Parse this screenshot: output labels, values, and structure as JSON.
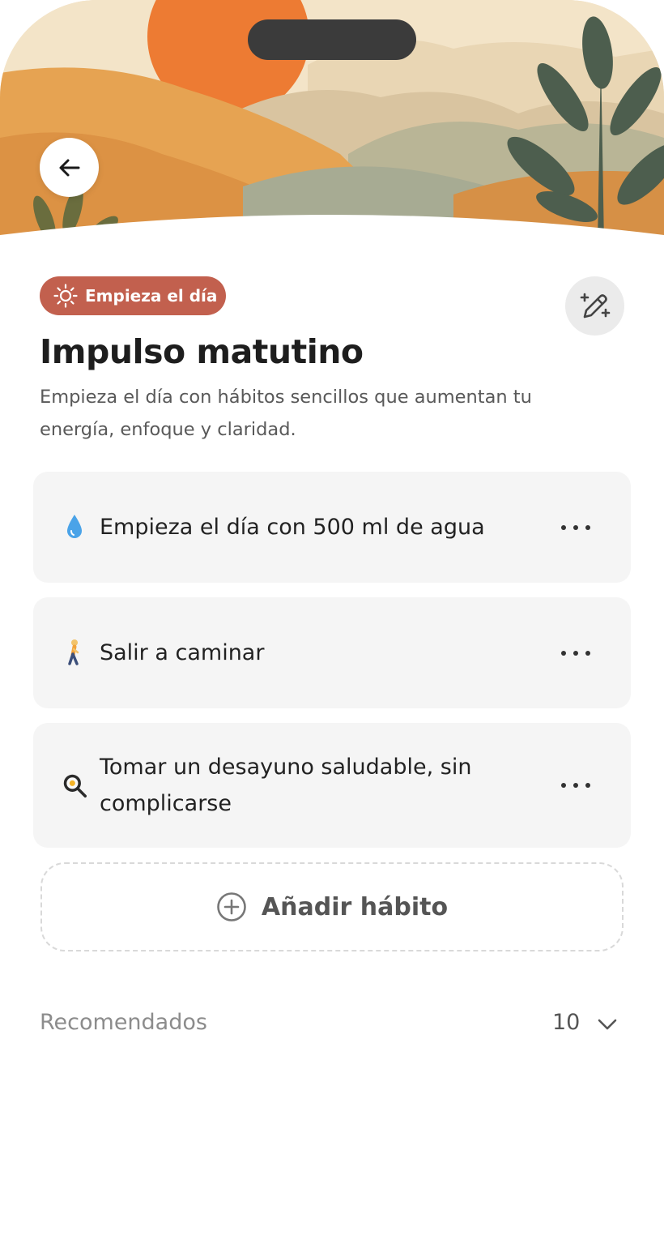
{
  "header": {
    "back_icon": "arrow-left-icon",
    "hero_illustration": "landscape-illustration"
  },
  "routine": {
    "tag": {
      "icon": "sun-icon",
      "label": "Empieza el día",
      "color": "#c2604e"
    },
    "edit_icon": "magic-wand-edit-icon",
    "title": "Impulso matutino",
    "description": "Empieza el día con hábitos sencillos que aumentan tu energía, enfoque y claridad."
  },
  "habits": [
    {
      "emoji": "water-drop-icon",
      "label": "Empieza el día con 500 ml de agua",
      "menu_icon": "more-horizontal-icon"
    },
    {
      "emoji": "person-walking-icon",
      "label": "Salir a caminar",
      "menu_icon": "more-horizontal-icon"
    },
    {
      "emoji": "frying-pan-egg-icon",
      "label": "Tomar un desayuno saludable, sin complicarse",
      "menu_icon": "more-horizontal-icon"
    }
  ],
  "add_habit": {
    "icon": "plus-circle-icon",
    "label": "Añadir hábito"
  },
  "recommended": {
    "label": "Recomendados",
    "count": "10",
    "icon": "chevron-down-icon"
  },
  "colors": {
    "tag_background": "#c2604e",
    "card_background": "#f5f5f5",
    "edit_button_background": "#ebebeb"
  }
}
